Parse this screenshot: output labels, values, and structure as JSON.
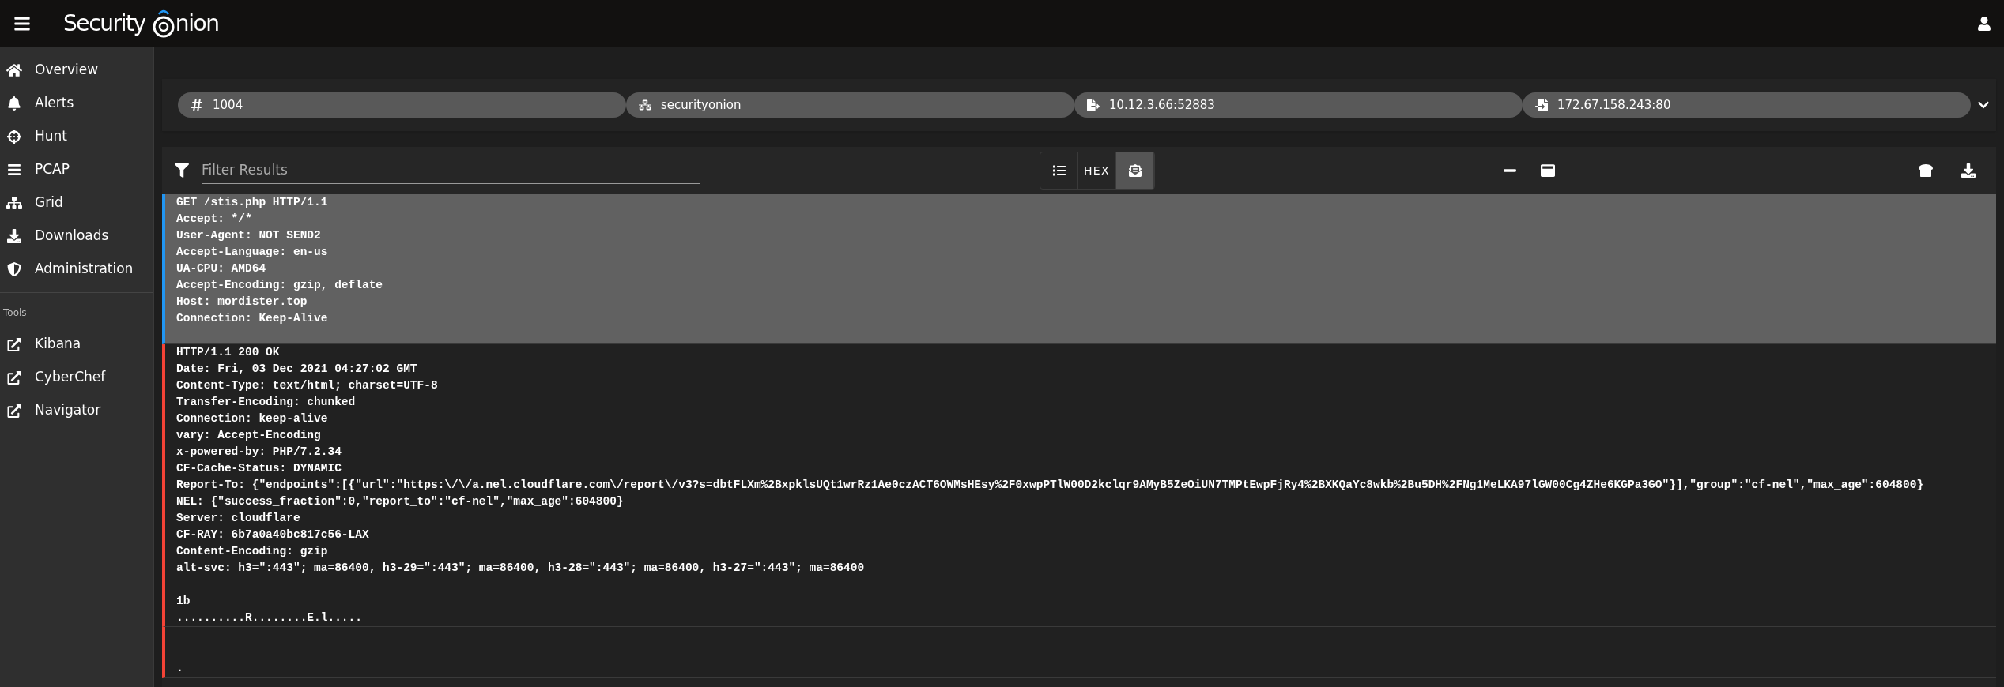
{
  "app_bar": {
    "logo_left": "Security",
    "logo_right": "nion"
  },
  "sidebar": {
    "items": [
      {
        "label": "Overview",
        "selected": false
      },
      {
        "label": "Alerts",
        "selected": false
      },
      {
        "label": "Hunt",
        "selected": false
      },
      {
        "label": "PCAP",
        "selected": false
      },
      {
        "label": "Grid",
        "selected": false
      },
      {
        "label": "Downloads",
        "selected": false
      },
      {
        "label": "Administration",
        "selected": false
      }
    ],
    "tools_heading": "Tools",
    "tools": [
      {
        "label": "Kibana"
      },
      {
        "label": "CyberChef"
      },
      {
        "label": "Navigator"
      }
    ]
  },
  "chips": [
    {
      "text": "1004"
    },
    {
      "text": "securityonion"
    },
    {
      "text": "10.12.3.66:52883"
    },
    {
      "text": "172.67.158.243:80"
    }
  ],
  "filter": {
    "placeholder": "Filter Results"
  },
  "view_modes": [
    {
      "kind": "icon",
      "selected": false
    },
    {
      "kind": "text",
      "label": "HEX",
      "selected": false
    },
    {
      "kind": "icon",
      "selected": true
    }
  ],
  "packets": [
    {
      "kind": "client",
      "selected": true,
      "text": "GET /stis.php HTTP/1.1\nAccept: */*\nUser-Agent: NOT SEND2\nAccept-Language: en-us\nUA-CPU: AMD64\nAccept-Encoding: gzip, deflate\nHost: mordister.top\nConnection: Keep-Alive\n "
    },
    {
      "kind": "server",
      "selected": false,
      "text": "HTTP/1.1 200 OK\nDate: Fri, 03 Dec 2021 04:27:02 GMT\nContent-Type: text/html; charset=UTF-8\nTransfer-Encoding: chunked\nConnection: keep-alive\nvary: Accept-Encoding\nx-powered-by: PHP/7.2.34\nCF-Cache-Status: DYNAMIC\nReport-To: {\"endpoints\":[{\"url\":\"https:\\/\\/a.nel.cloudflare.com\\/report\\/v3?s=dbtFLXm%2BxpklsUQt1wrRz1Ae0czACT6OWMsHEsy%2F0xwpPTlW00D2kclqr9AMyB5ZeOiUN7TMPtEwpFjRy4%2BXKQaYc8wkb%2Bu5DH%2FNg1MeLKA97lGW00Cg4ZHe6KGPa3GO\"}],\"group\":\"cf-nel\",\"max_age\":604800}\nNEL: {\"success_fraction\":0,\"report_to\":\"cf-nel\",\"max_age\":604800}\nServer: cloudflare\nCF-RAY: 6b7a0a40bc817c56-LAX\nContent-Encoding: gzip\nalt-svc: h3=\":443\"; ma=86400, h3-29=\":443\"; ma=86400, h3-28=\":443\"; ma=86400, h3-27=\":443\"; ma=86400\n\n1b\n..........R........E.l....."
    },
    {
      "kind": "server",
      "selected": false,
      "text": "\n\n."
    }
  ]
}
